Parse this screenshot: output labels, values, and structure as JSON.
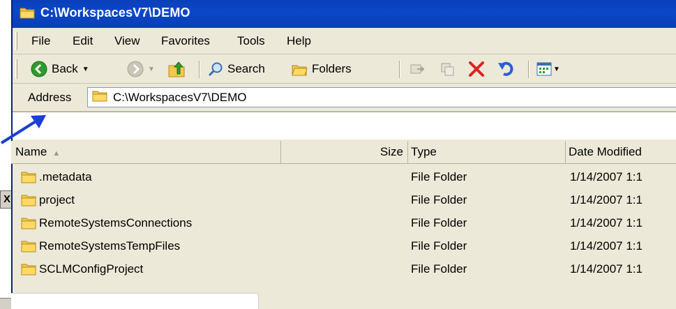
{
  "window": {
    "title": "C:\\WorkspacesV7\\DEMO"
  },
  "menu": [
    "File",
    "Edit",
    "View",
    "Favorites",
    "Tools",
    "Help"
  ],
  "toolbar": {
    "back_label": "Back",
    "search_label": "Search",
    "folders_label": "Folders",
    "icons": [
      "back-arrow-icon",
      "forward-arrow-icon",
      "up-folder-icon",
      "search-magnifier-icon",
      "folders-icon",
      "move-to-icon",
      "copy-to-icon",
      "delete-x-icon",
      "undo-icon",
      "views-icon"
    ]
  },
  "address": {
    "label": "Address",
    "value": "C:\\WorkspacesV7\\DEMO"
  },
  "columns": {
    "name": "Name",
    "size": "Size",
    "type": "Type",
    "date": "Date Modified"
  },
  "rows": [
    {
      "name": ".metadata",
      "type": "File Folder",
      "date": "1/14/2007 1:1"
    },
    {
      "name": "project",
      "type": "File Folder",
      "date": "1/14/2007 1:1"
    },
    {
      "name": "RemoteSystemsConnections",
      "type": "File Folder",
      "date": "1/14/2007 1:1"
    },
    {
      "name": "RemoteSystemsTempFiles",
      "type": "File Folder",
      "date": "1/14/2007 1:1"
    },
    {
      "name": "SCLMConfigProject",
      "type": "File Folder",
      "date": "1/14/2007 1:1"
    }
  ],
  "background": {
    "close_glyph": "X"
  },
  "colors": {
    "titlebar": "#0a47c9",
    "chrome": "#ece9d8",
    "folder": "#f2c94c",
    "annotation_arrow": "#1a3ed8",
    "delete": "#e02020"
  }
}
